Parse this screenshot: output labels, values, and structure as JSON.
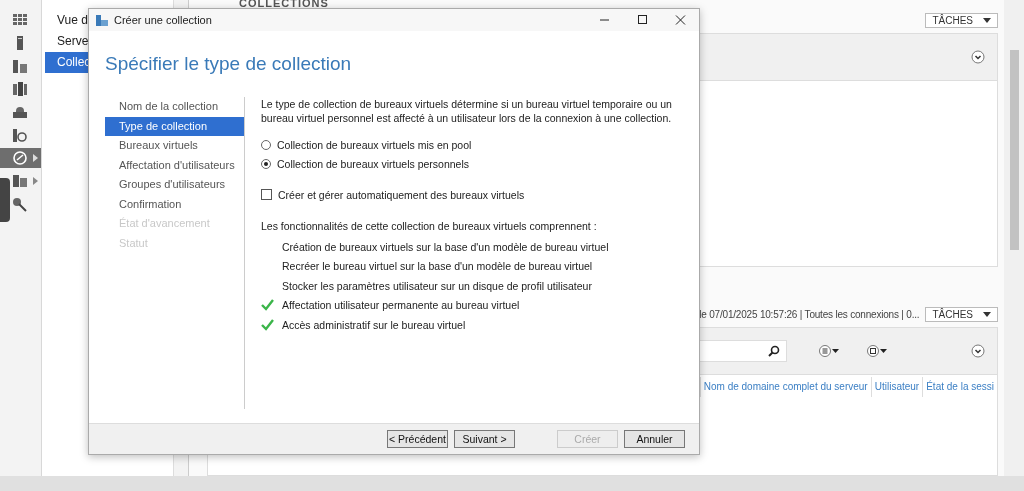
{
  "app": {
    "heading": "COLLECTIONS",
    "rail": [
      {
        "selected": false,
        "submenu": false
      },
      {
        "selected": false,
        "submenu": false
      },
      {
        "selected": false,
        "submenu": false
      },
      {
        "selected": false,
        "submenu": false
      },
      {
        "selected": false,
        "submenu": false
      },
      {
        "selected": false,
        "submenu": false
      },
      {
        "selected": true,
        "submenu": true
      },
      {
        "selected": false,
        "submenu": true
      },
      {
        "selected": false,
        "submenu": false
      }
    ],
    "nav": [
      {
        "label": "Vue d",
        "selected": false
      },
      {
        "label": "Serve",
        "selected": false
      },
      {
        "label": "Collec",
        "selected": true
      }
    ],
    "top_panel": {
      "tasks_label": "TÂCHES"
    },
    "bottom_panel": {
      "status": "le 07/01/2025 10:57:26 | Toutes les connexions | 0...",
      "tasks_label": "TÂCHES",
      "columns": [
        "Nom de domaine complet du serveur",
        "Utilisateur",
        "État de la sessi"
      ]
    }
  },
  "dialog": {
    "title": "Créer une collection",
    "heading": "Spécifier le type de collection",
    "steps": [
      {
        "label": "Nom de la collection",
        "selected": false,
        "disabled": false
      },
      {
        "label": "Type de collection",
        "selected": true,
        "disabled": false
      },
      {
        "label": "Bureaux virtuels",
        "selected": false,
        "disabled": false
      },
      {
        "label": "Affectation d'utilisateurs",
        "selected": false,
        "disabled": false
      },
      {
        "label": "Groupes d'utilisateurs",
        "selected": false,
        "disabled": false
      },
      {
        "label": "Confirmation",
        "selected": false,
        "disabled": false
      },
      {
        "label": "État d'avancement",
        "selected": false,
        "disabled": true
      },
      {
        "label": "Statut",
        "selected": false,
        "disabled": true
      }
    ],
    "intro": "Le type de collection de bureaux virtuels détermine si un bureau virtuel temporaire ou un bureau virtuel personnel est affecté à un utilisateur lors de la connexion à une collection.",
    "options": [
      {
        "label": "Collection de bureaux virtuels mis en pool",
        "selected": false
      },
      {
        "label": "Collection de bureaux virtuels personnels",
        "selected": true
      }
    ],
    "auto_create": {
      "label": "Créer et gérer automatiquement des bureaux virtuels",
      "checked": false
    },
    "features_title": "Les fonctionnalités de cette collection de bureaux virtuels comprennent :",
    "features": [
      {
        "label": "Création de bureaux virtuels sur la base d'un modèle de bureau virtuel",
        "available": false
      },
      {
        "label": "Recréer le bureau virtuel sur la base d'un modèle de bureau virtuel",
        "available": false
      },
      {
        "label": "Stocker les paramètres utilisateur sur un disque de profil utilisateur",
        "available": false
      },
      {
        "label": "Affectation utilisateur permanente au bureau virtuel",
        "available": true
      },
      {
        "label": "Accès administratif sur le bureau virtuel",
        "available": true
      }
    ],
    "buttons": [
      {
        "label": "< Précédent",
        "disabled": false
      },
      {
        "label": "Suivant >",
        "disabled": false
      },
      {
        "label": "Créer",
        "disabled": true
      },
      {
        "label": "Annuler",
        "disabled": false
      }
    ]
  }
}
